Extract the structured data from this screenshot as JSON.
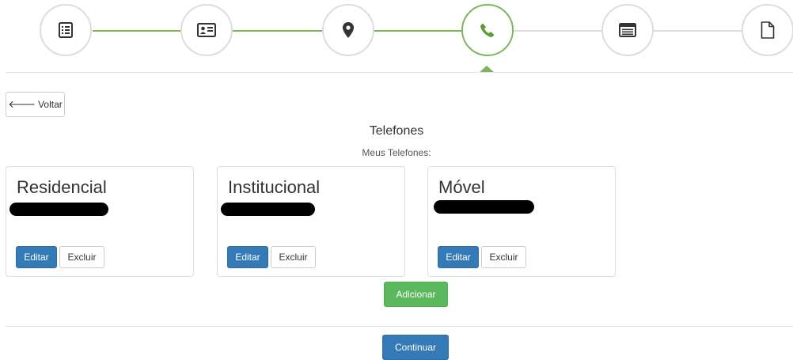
{
  "stepper": {
    "active_step": 4,
    "steps": [
      {
        "icon": "list-icon",
        "status": "done"
      },
      {
        "icon": "id-card-icon",
        "status": "done"
      },
      {
        "icon": "map-marker-icon",
        "status": "done"
      },
      {
        "icon": "phone-icon",
        "status": "active"
      },
      {
        "icon": "table-list-icon",
        "status": "pending"
      },
      {
        "icon": "document-icon",
        "status": "pending"
      }
    ],
    "colors": {
      "done": "#7db55c",
      "pending": "#dddddd",
      "icon": "#333333",
      "active_icon": "#5a9e3a"
    }
  },
  "back_button": {
    "label": "Voltar",
    "icon": "arrow-left-icon"
  },
  "section": {
    "title": "Telefones",
    "subtitle": "Meus Telefones:"
  },
  "phones": [
    {
      "type": "Residencial",
      "number_redacted": true,
      "edit_label": "Editar",
      "delete_label": "Excluir"
    },
    {
      "type": "Institucional",
      "number_redacted": true,
      "edit_label": "Editar",
      "delete_label": "Excluir"
    },
    {
      "type": "Móvel",
      "number_redacted": true,
      "edit_label": "Editar",
      "delete_label": "Excluir"
    }
  ],
  "add_button": {
    "label": "Adicionar"
  },
  "continue_button": {
    "label": "Continuar"
  },
  "colors": {
    "primary": "#337ab7",
    "success": "#5cb85c",
    "accent": "#7db55c"
  }
}
